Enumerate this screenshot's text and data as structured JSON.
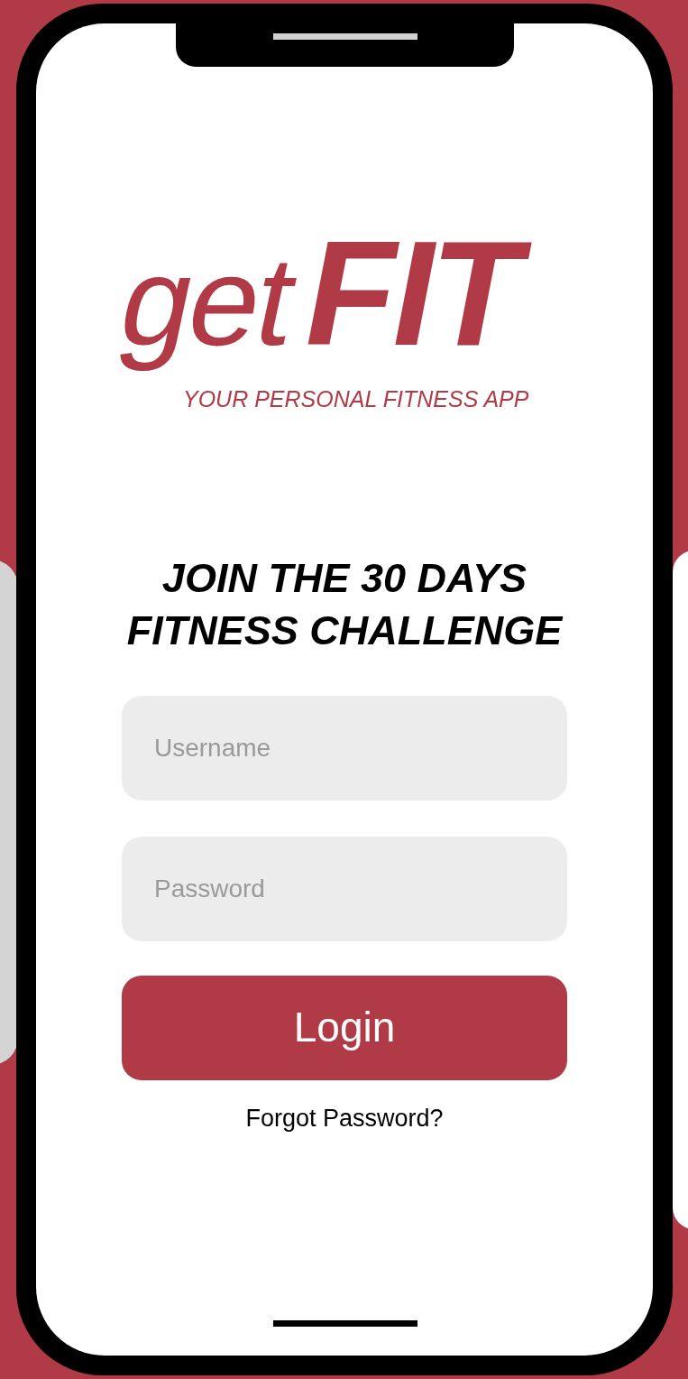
{
  "logo": {
    "word_light": "get",
    "word_bold": "FIT",
    "tagline": "YOUR PERSONAL FITNESS APP"
  },
  "heading": "JOIN THE 30 DAYS FITNESS CHALLENGE",
  "fields": [
    {
      "placeholder": "Username"
    },
    {
      "placeholder": "Password"
    }
  ],
  "login_button": "Login",
  "forgot_link": "Forgot Password?"
}
